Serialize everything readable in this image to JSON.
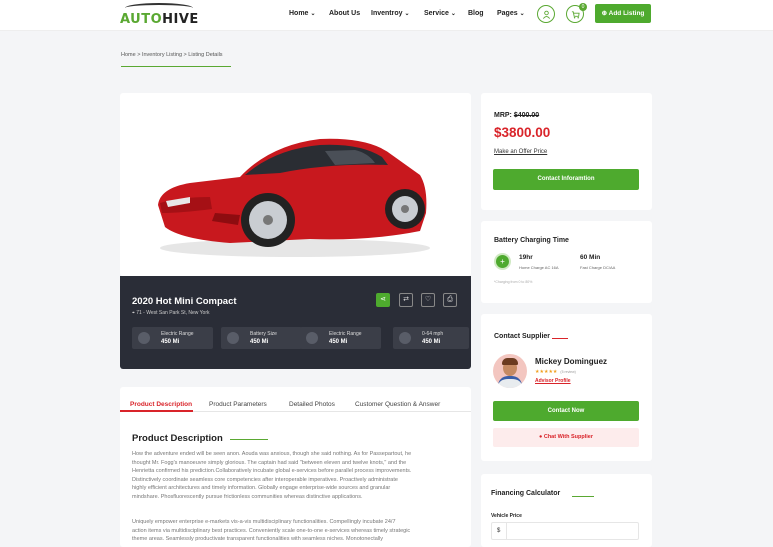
{
  "brand": {
    "logo_prefix": "AUTO",
    "logo_suffix": "HIVE",
    "accent": "#4eaa2e",
    "danger": "#d9242a"
  },
  "nav": {
    "items": [
      {
        "label": "Home",
        "dropdown": true
      },
      {
        "label": "About Us",
        "dropdown": false
      },
      {
        "label": "Inventroy",
        "dropdown": true
      },
      {
        "label": "Service",
        "dropdown": true
      },
      {
        "label": "Blog",
        "dropdown": false
      },
      {
        "label": "Pages",
        "dropdown": true
      }
    ],
    "user_icon": "user-icon",
    "cart_icon": "cart-icon",
    "cart_count": "0",
    "add_listing": "Add Listing"
  },
  "breadcrumb": {
    "home": "Home",
    "sep": ">",
    "inventory": "Inventory Listing",
    "current": "Listing Details"
  },
  "listing": {
    "title": "2020 Hot Mini Compact",
    "address": "71 - West San Park St, New York",
    "actions": [
      "share-icon",
      "compare-icon",
      "heart-icon",
      "print-icon"
    ],
    "specs": [
      {
        "label": "Electric Range",
        "value": "450 Mi"
      },
      {
        "label": "Battery Size",
        "value": "450 Mi"
      },
      {
        "label": "Electric Range",
        "value": "450 Mi"
      },
      {
        "label": "0-64 mph",
        "value": "450 Mi"
      }
    ]
  },
  "tabs": [
    "Product Description",
    "Product  Parameters",
    "Detailed Photos",
    "Customer Question & Answer"
  ],
  "description": {
    "title": "Product Description",
    "p1": [
      "How the adventure ended will be seen anon. Aouda was anxious, though she said nothing. As for Passepartout, he",
      "thought Mr. Fogg's manoeuvre simply glorious. The captain had said \"between eleven and twelve knots,\" and the",
      "Henrietta confirmed his prediction.Collaboratively incubate global e-services before parallel process improvements.",
      "Distinctively coordinate seamless core competencies after interoperable imperatives. Proactively administrate",
      "highly efficient architectures and timely information. Globally engage enterprise-wide sources and granular",
      "mindshare. Phosfluorescently pursue frictionless communities whereas distinctive applications."
    ],
    "p2": [
      "Uniquely empower enterprise e-markets vis-a-vis multidisciplinary functionalities. Compellingly incubate 24/7",
      "action items via multidisciplinary best practices. Conveniently scale one-to-one e-services whereas timely strategic",
      "theme areas. Seamlessly productivate transparent functionalities with seamless niches. Monotonectally"
    ]
  },
  "price": {
    "mrp_label": "MRP:",
    "mrp": "$400.00",
    "price": "$3800.00",
    "offer": "Make an Offer Price",
    "contact": "Contact Inforamtion"
  },
  "battery": {
    "title": "Battery Charging Time",
    "icon": "plus-icon",
    "home_value": "19hr",
    "home_label": "Home Charge AC 16A",
    "fast_value": "60 Min",
    "fast_label": "Fast Charge DC/AA",
    "note": "*Charging from 0 to 80%"
  },
  "supplier": {
    "title": "Contact Supplier",
    "name": "Mickey Dominguez",
    "rating": "★★★★★",
    "reviews": "(5 review)",
    "profile": "Advisor Profile",
    "contact": "Contact Now",
    "chat": "Chat With  Supplier"
  },
  "finance": {
    "title": "Financing Calculator",
    "vehicle_price_label": "Vehicle Price",
    "currency": "$"
  }
}
